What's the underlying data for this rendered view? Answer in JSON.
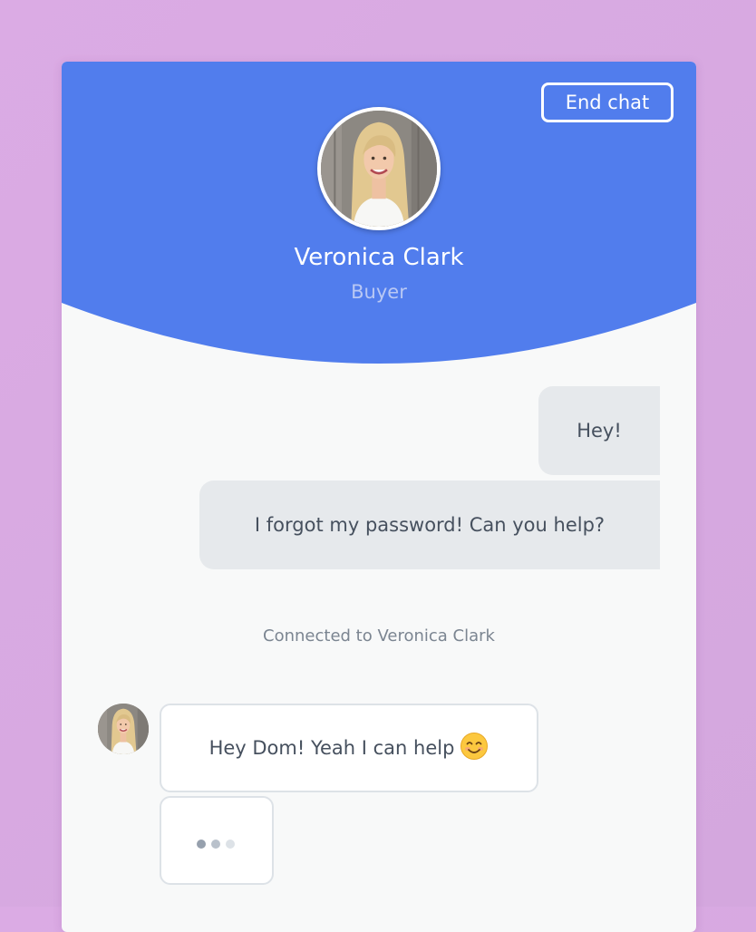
{
  "colors": {
    "page_background": "#dbabe4",
    "header_accent": "#517ded",
    "card_background": "#f8f9f9",
    "outgoing_bubble": "#e6e9ec",
    "incoming_bubble_border": "#dde2e7"
  },
  "header": {
    "end_chat_label": "End chat",
    "agent_name": "Veronica Clark",
    "agent_role": "Buyer",
    "avatar_icon": "avatar-photo"
  },
  "messages": {
    "outgoing": [
      {
        "text": "Hey!"
      },
      {
        "text": "I forgot my password! Can you help?"
      }
    ],
    "status": "Connected to Veronica Clark",
    "incoming": [
      {
        "text": "Hey Dom! Yeah I can help",
        "emoji": "smiling-face-icon"
      }
    ],
    "typing_indicator": {
      "icon": "typing-dots-icon"
    }
  }
}
